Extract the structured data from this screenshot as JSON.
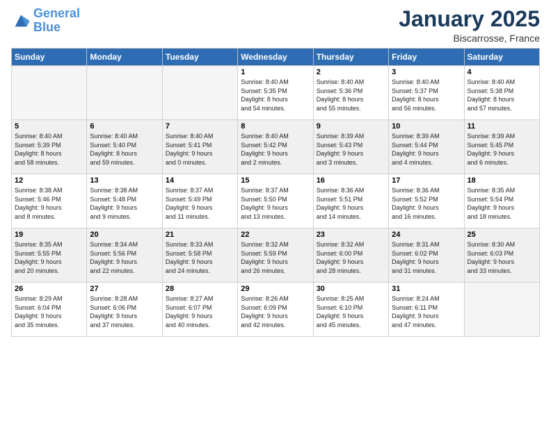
{
  "header": {
    "logo_line1": "General",
    "logo_line2": "Blue",
    "month": "January 2025",
    "location": "Biscarrosse, France"
  },
  "weekdays": [
    "Sunday",
    "Monday",
    "Tuesday",
    "Wednesday",
    "Thursday",
    "Friday",
    "Saturday"
  ],
  "weeks": [
    [
      {
        "day": "",
        "info": ""
      },
      {
        "day": "",
        "info": ""
      },
      {
        "day": "",
        "info": ""
      },
      {
        "day": "1",
        "info": "Sunrise: 8:40 AM\nSunset: 5:35 PM\nDaylight: 8 hours\nand 54 minutes."
      },
      {
        "day": "2",
        "info": "Sunrise: 8:40 AM\nSunset: 5:36 PM\nDaylight: 8 hours\nand 55 minutes."
      },
      {
        "day": "3",
        "info": "Sunrise: 8:40 AM\nSunset: 5:37 PM\nDaylight: 8 hours\nand 56 minutes."
      },
      {
        "day": "4",
        "info": "Sunrise: 8:40 AM\nSunset: 5:38 PM\nDaylight: 8 hours\nand 57 minutes."
      }
    ],
    [
      {
        "day": "5",
        "info": "Sunrise: 8:40 AM\nSunset: 5:39 PM\nDaylight: 8 hours\nand 58 minutes."
      },
      {
        "day": "6",
        "info": "Sunrise: 8:40 AM\nSunset: 5:40 PM\nDaylight: 8 hours\nand 59 minutes."
      },
      {
        "day": "7",
        "info": "Sunrise: 8:40 AM\nSunset: 5:41 PM\nDaylight: 9 hours\nand 0 minutes."
      },
      {
        "day": "8",
        "info": "Sunrise: 8:40 AM\nSunset: 5:42 PM\nDaylight: 9 hours\nand 2 minutes."
      },
      {
        "day": "9",
        "info": "Sunrise: 8:39 AM\nSunset: 5:43 PM\nDaylight: 9 hours\nand 3 minutes."
      },
      {
        "day": "10",
        "info": "Sunrise: 8:39 AM\nSunset: 5:44 PM\nDaylight: 9 hours\nand 4 minutes."
      },
      {
        "day": "11",
        "info": "Sunrise: 8:39 AM\nSunset: 5:45 PM\nDaylight: 9 hours\nand 6 minutes."
      }
    ],
    [
      {
        "day": "12",
        "info": "Sunrise: 8:38 AM\nSunset: 5:46 PM\nDaylight: 9 hours\nand 8 minutes."
      },
      {
        "day": "13",
        "info": "Sunrise: 8:38 AM\nSunset: 5:48 PM\nDaylight: 9 hours\nand 9 minutes."
      },
      {
        "day": "14",
        "info": "Sunrise: 8:37 AM\nSunset: 5:49 PM\nDaylight: 9 hours\nand 11 minutes."
      },
      {
        "day": "15",
        "info": "Sunrise: 8:37 AM\nSunset: 5:50 PM\nDaylight: 9 hours\nand 13 minutes."
      },
      {
        "day": "16",
        "info": "Sunrise: 8:36 AM\nSunset: 5:51 PM\nDaylight: 9 hours\nand 14 minutes."
      },
      {
        "day": "17",
        "info": "Sunrise: 8:36 AM\nSunset: 5:52 PM\nDaylight: 9 hours\nand 16 minutes."
      },
      {
        "day": "18",
        "info": "Sunrise: 8:35 AM\nSunset: 5:54 PM\nDaylight: 9 hours\nand 18 minutes."
      }
    ],
    [
      {
        "day": "19",
        "info": "Sunrise: 8:35 AM\nSunset: 5:55 PM\nDaylight: 9 hours\nand 20 minutes."
      },
      {
        "day": "20",
        "info": "Sunrise: 8:34 AM\nSunset: 5:56 PM\nDaylight: 9 hours\nand 22 minutes."
      },
      {
        "day": "21",
        "info": "Sunrise: 8:33 AM\nSunset: 5:58 PM\nDaylight: 9 hours\nand 24 minutes."
      },
      {
        "day": "22",
        "info": "Sunrise: 8:32 AM\nSunset: 5:59 PM\nDaylight: 9 hours\nand 26 minutes."
      },
      {
        "day": "23",
        "info": "Sunrise: 8:32 AM\nSunset: 6:00 PM\nDaylight: 9 hours\nand 28 minutes."
      },
      {
        "day": "24",
        "info": "Sunrise: 8:31 AM\nSunset: 6:02 PM\nDaylight: 9 hours\nand 31 minutes."
      },
      {
        "day": "25",
        "info": "Sunrise: 8:30 AM\nSunset: 6:03 PM\nDaylight: 9 hours\nand 33 minutes."
      }
    ],
    [
      {
        "day": "26",
        "info": "Sunrise: 8:29 AM\nSunset: 6:04 PM\nDaylight: 9 hours\nand 35 minutes."
      },
      {
        "day": "27",
        "info": "Sunrise: 8:28 AM\nSunset: 6:06 PM\nDaylight: 9 hours\nand 37 minutes."
      },
      {
        "day": "28",
        "info": "Sunrise: 8:27 AM\nSunset: 6:07 PM\nDaylight: 9 hours\nand 40 minutes."
      },
      {
        "day": "29",
        "info": "Sunrise: 8:26 AM\nSunset: 6:09 PM\nDaylight: 9 hours\nand 42 minutes."
      },
      {
        "day": "30",
        "info": "Sunrise: 8:25 AM\nSunset: 6:10 PM\nDaylight: 9 hours\nand 45 minutes."
      },
      {
        "day": "31",
        "info": "Sunrise: 8:24 AM\nSunset: 6:11 PM\nDaylight: 9 hours\nand 47 minutes."
      },
      {
        "day": "",
        "info": ""
      }
    ]
  ]
}
